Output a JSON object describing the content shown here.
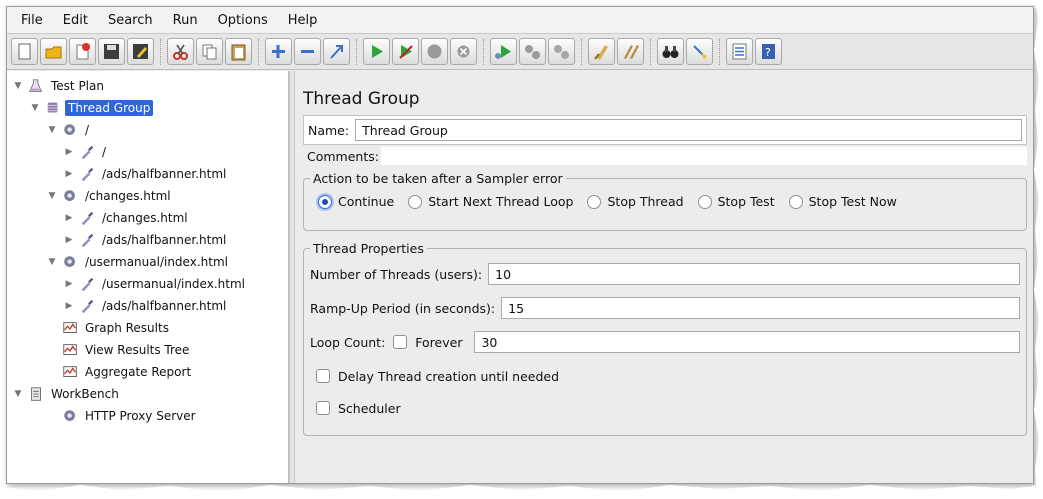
{
  "menu": [
    "File",
    "Edit",
    "Search",
    "Run",
    "Options",
    "Help"
  ],
  "toolbar": {
    "buttons": [
      "new-icon",
      "open-folder-icon",
      "templates-icon",
      "save-icon",
      "save-as-icon",
      "cut-icon",
      "copy-icon",
      "paste-icon",
      "expand-icon",
      "collapse-icon",
      "toggle-icon",
      "start-icon",
      "start-no-timers-icon",
      "stop-icon",
      "shutdown-icon",
      "remote-start-icon",
      "remote-stop-icon",
      "remote-shutdown-icon",
      "clear-icon",
      "clear-all-icon",
      "search-binoculars-icon",
      "reset-search-broom-icon",
      "function-helper-icon",
      "help-icon"
    ]
  },
  "tree": [
    {
      "label": "Test Plan",
      "icon": "flask-icon",
      "depth": 0,
      "twist": "down"
    },
    {
      "label": "Thread Group",
      "icon": "spool-icon",
      "depth": 1,
      "twist": "down",
      "selected": true
    },
    {
      "label": "/",
      "icon": "gear-icon",
      "depth": 2,
      "twist": "down"
    },
    {
      "label": "/",
      "icon": "pipette-icon",
      "depth": 3,
      "twist": "right"
    },
    {
      "label": "/ads/halfbanner.html",
      "icon": "pipette-icon",
      "depth": 3,
      "twist": "right"
    },
    {
      "label": "/changes.html",
      "icon": "gear-icon",
      "depth": 2,
      "twist": "down"
    },
    {
      "label": "/changes.html",
      "icon": "pipette-icon",
      "depth": 3,
      "twist": "right"
    },
    {
      "label": "/ads/halfbanner.html",
      "icon": "pipette-icon",
      "depth": 3,
      "twist": "right"
    },
    {
      "label": "/usermanual/index.html",
      "icon": "gear-icon",
      "depth": 2,
      "twist": "down"
    },
    {
      "label": "/usermanual/index.html",
      "icon": "pipette-icon",
      "depth": 3,
      "twist": "right"
    },
    {
      "label": "/ads/halfbanner.html",
      "icon": "pipette-icon",
      "depth": 3,
      "twist": "right"
    },
    {
      "label": "Graph Results",
      "icon": "graph-icon",
      "depth": 2,
      "twist": "none"
    },
    {
      "label": "View Results Tree",
      "icon": "graph-icon",
      "depth": 2,
      "twist": "none"
    },
    {
      "label": "Aggregate Report",
      "icon": "graph-icon",
      "depth": 2,
      "twist": "none"
    },
    {
      "label": "WorkBench",
      "icon": "clipboard-icon",
      "depth": 0,
      "twist": "down"
    },
    {
      "label": "HTTP Proxy Server",
      "icon": "gear-icon",
      "depth": 2,
      "twist": "none"
    }
  ],
  "editor": {
    "title": "Thread Group",
    "name_label": "Name:",
    "name_value": "Thread Group",
    "comments_label": "Comments:",
    "comments_value": "",
    "error_legend": "Action to be taken after a Sampler error",
    "error_options": [
      {
        "label": "Continue",
        "checked": true
      },
      {
        "label": "Start Next Thread Loop",
        "checked": false
      },
      {
        "label": "Stop Thread",
        "checked": false
      },
      {
        "label": "Stop Test",
        "checked": false
      },
      {
        "label": "Stop Test Now",
        "checked": false
      }
    ],
    "props_legend": "Thread Properties",
    "threads_label": "Number of Threads (users):",
    "threads_value": "10",
    "rampup_label": "Ramp-Up Period (in seconds):",
    "rampup_value": "15",
    "loop_label": "Loop Count:",
    "forever_label": "Forever",
    "forever_checked": false,
    "loop_value": "30",
    "delay_label": "Delay Thread creation until needed",
    "delay_checked": false,
    "scheduler_label": "Scheduler",
    "scheduler_checked": false
  }
}
